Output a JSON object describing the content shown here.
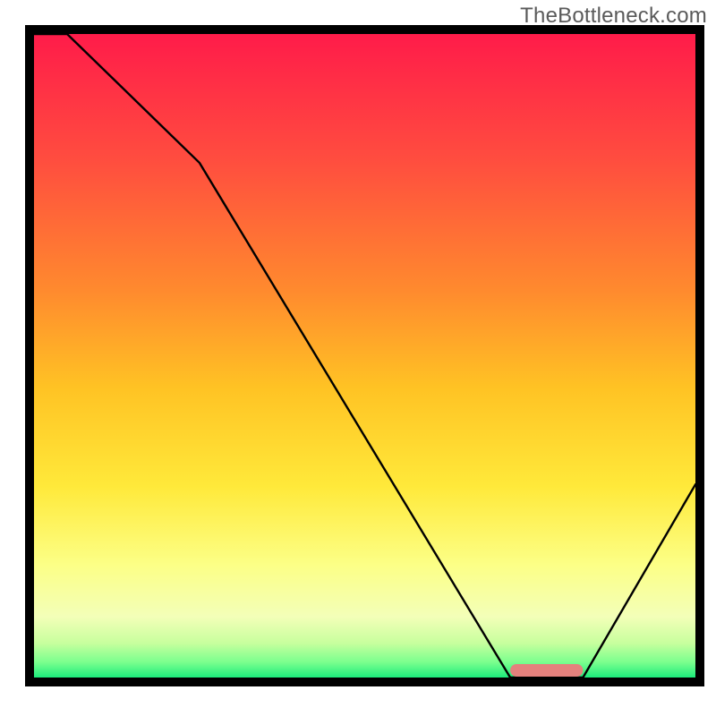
{
  "watermark": {
    "text": "TheBottleneck.com"
  },
  "chart_data": {
    "type": "line",
    "title": "",
    "xlabel": "",
    "ylabel": "",
    "x": [
      0,
      5,
      25,
      72,
      78,
      83,
      100
    ],
    "values": [
      110,
      100,
      80,
      0,
      0,
      0,
      30
    ],
    "ylim": [
      0,
      100
    ],
    "xlim": [
      0,
      100
    ],
    "marker": {
      "x_start": 72,
      "x_end": 83,
      "y": 0,
      "color": "#e4817d"
    },
    "background_gradient": {
      "stops": [
        {
          "offset": 0,
          "color": "#ff1a4a"
        },
        {
          "offset": 20,
          "color": "#ff4d3f"
        },
        {
          "offset": 40,
          "color": "#ff8a2e"
        },
        {
          "offset": 55,
          "color": "#ffc324"
        },
        {
          "offset": 70,
          "color": "#ffe93a"
        },
        {
          "offset": 82,
          "color": "#fcff86"
        },
        {
          "offset": 90,
          "color": "#f3ffb8"
        },
        {
          "offset": 94,
          "color": "#c8ff9e"
        },
        {
          "offset": 97,
          "color": "#7aff8e"
        },
        {
          "offset": 100,
          "color": "#00e676"
        }
      ]
    }
  }
}
